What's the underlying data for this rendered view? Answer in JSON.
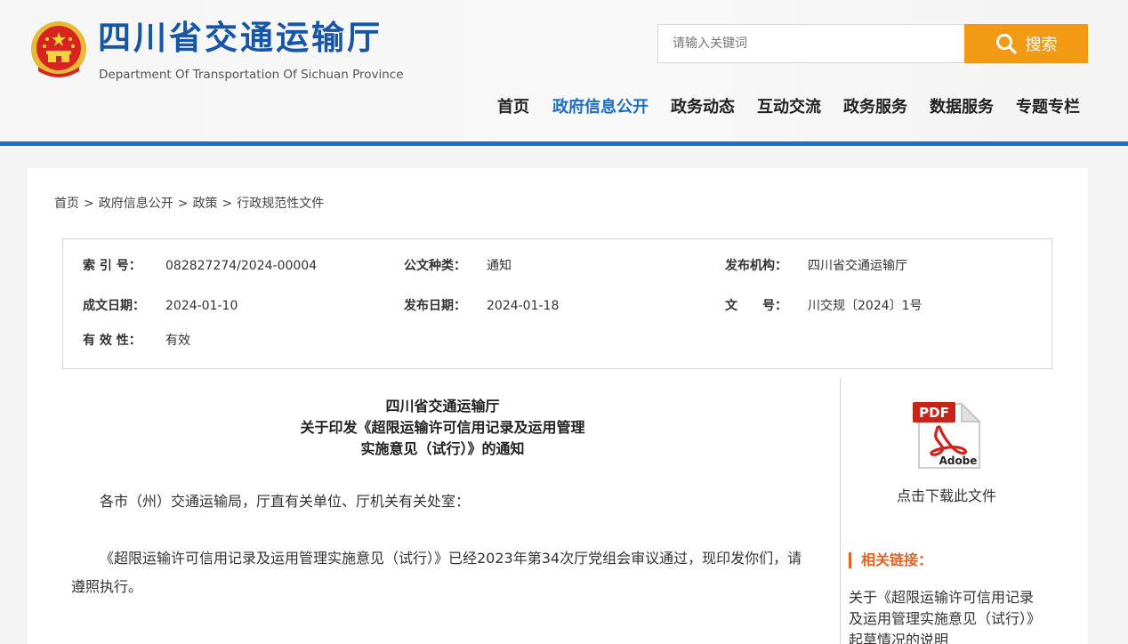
{
  "header": {
    "site_title": "四川省交通运输厅",
    "site_subtitle": "Department Of Transportation Of Sichuan Province",
    "search": {
      "placeholder": "请输入关键词",
      "button_label": "搜索"
    },
    "nav": [
      {
        "label": "首页",
        "active": false
      },
      {
        "label": "政府信息公开",
        "active": true
      },
      {
        "label": "政务动态",
        "active": false
      },
      {
        "label": "互动交流",
        "active": false
      },
      {
        "label": "政务服务",
        "active": false
      },
      {
        "label": "数据服务",
        "active": false
      },
      {
        "label": "专题专栏",
        "active": false
      }
    ]
  },
  "breadcrumb": [
    "首页",
    "政府信息公开",
    "政策",
    "行政规范性文件"
  ],
  "breadcrumb_separator": ">",
  "meta": {
    "index_label": "索 引 号：",
    "index_value": "082827274/2024-00004",
    "type_label": "公文种类：",
    "type_value": "通知",
    "org_label": "发布机构：",
    "org_value": "四川省交通运输厅",
    "written_label": "成文日期：",
    "written_value": "2024-01-10",
    "publish_label": "发布日期：",
    "publish_value": "2024-01-18",
    "docno_label": "文　　号：",
    "docno_value": "川交规〔2024〕1号",
    "valid_label": "有 效 性：",
    "valid_value": "有效"
  },
  "document": {
    "title_lines": [
      "四川省交通运输厅",
      "关于印发《超限运输许可信用记录及运用管理",
      "实施意见（试行）》的通知"
    ],
    "salutation": "各市（州）交通运输局，厅直有关单位、厅机关有关处室：",
    "body_line1": "《超限运输许可信用记录及运用管理实施意见（试行）》已经2023年第34次厅党组会审议通过，现印发你们，请",
    "body_line2": "遵照执行。"
  },
  "sidebar": {
    "pdf_label": "PDF",
    "adobe_label": "Adobe",
    "download_text": "点击下载此文件",
    "related_heading": "相关链接：",
    "related_link": "关于《超限运输许可信用记录及运用管理实施意见（试行）》起草情况的说明"
  },
  "colors": {
    "brand_blue": "#1e6dc2",
    "title_blue": "#1656a8",
    "search_orange": "#f29a13",
    "related_orange": "#e8611e"
  }
}
